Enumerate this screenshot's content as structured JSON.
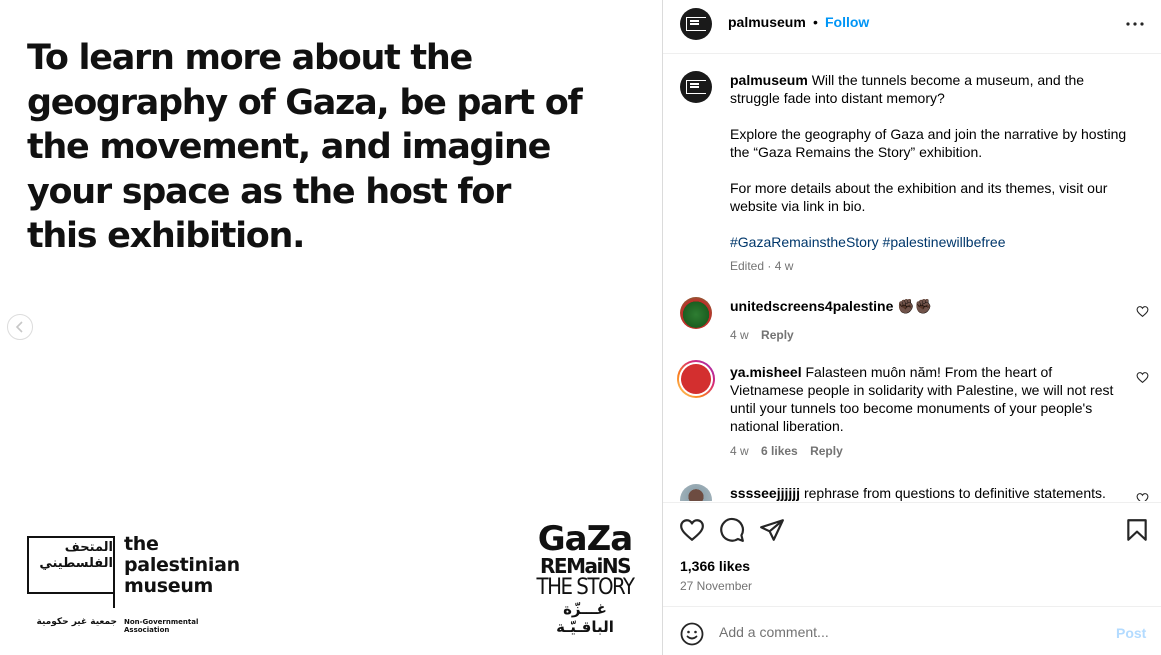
{
  "image": {
    "headline": "To learn more about the geography of Gaza, be part of the movement, and imagine your space as the host for this exhibition.",
    "logo_pm_arabic": "المتحف الفلسطيني",
    "logo_pm_english_1": "the",
    "logo_pm_english_2": "palestinian",
    "logo_pm_english_3": "museum",
    "logo_pm_sub_arabic": "جمعية غير حكومية",
    "logo_pm_sub_english": "Non-Governmental Association",
    "logo_gaza_1": "GaZa",
    "logo_gaza_2": "REMaiNS",
    "logo_gaza_3": "THE STORY",
    "logo_gaza_4": "غـــزّة الباقـيّـة"
  },
  "header": {
    "username": "palmuseum",
    "dot": "•",
    "follow": "Follow"
  },
  "caption": {
    "username": "palmuseum",
    "line1": "Will the tunnels become a museum, and the struggle fade into distant memory?",
    "line2": "Explore the geography of Gaza and join the narrative by hosting the “Gaza Remains the Story” exhibition.",
    "line3": "For more details about the exhibition and its themes, visit our website via link in bio.",
    "tag1": "#GazaRemainstheStory",
    "tag2": "#palestinewillbefree",
    "meta": "Edited · 4 w"
  },
  "comments": [
    {
      "username": "unitedscreens4palestine",
      "text": "✊🏿✊🏿",
      "time": "4 w",
      "likes": "",
      "reply": "Reply"
    },
    {
      "username": "ya.misheel",
      "text": "Falasteen muôn năm! From the heart of Vietnamese people in solidarity with Palestine, we will not rest until your tunnels too become monuments of your people's national liberation.",
      "time": "4 w",
      "likes": "6 likes",
      "reply": "Reply"
    },
    {
      "username": "sssseejjjjjj",
      "text": "rephrase from questions to definitive statements.",
      "time": "",
      "likes": "",
      "reply": ""
    }
  ],
  "footer": {
    "likes": "1,366 likes",
    "date": "27 November",
    "comment_placeholder": "Add a comment...",
    "post": "Post"
  },
  "colors": {
    "link": "#0095f6",
    "hashtag": "#00376b",
    "muted": "#737373",
    "post_disabled": "#b3dbff"
  },
  "icons": [
    "chevron-left-icon",
    "more-icon",
    "heart-icon",
    "comment-icon",
    "share-icon",
    "bookmark-icon",
    "emoji-icon"
  ]
}
